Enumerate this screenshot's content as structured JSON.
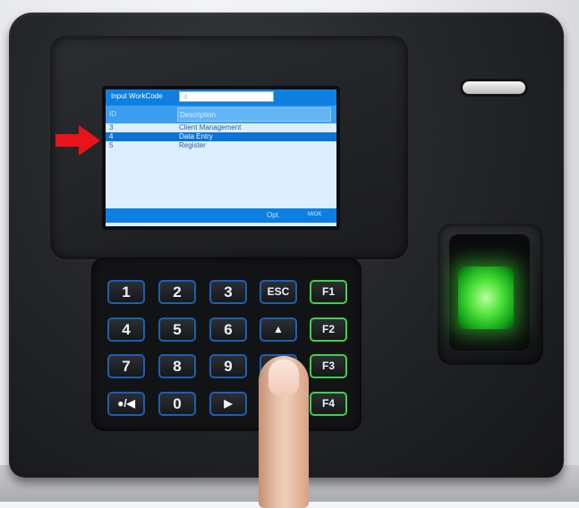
{
  "screen": {
    "input_label": "Input WorkCode",
    "input_value": "4",
    "header_col1": "ID",
    "header_col2": "Description",
    "rows": [
      {
        "id": "3",
        "desc": "Client Management",
        "selected": false
      },
      {
        "id": "4",
        "desc": "Data Entry",
        "selected": true
      },
      {
        "id": "5",
        "desc": "Register",
        "selected": false
      }
    ],
    "footer_opt": "Opt.",
    "footer_ok": "M/OK"
  },
  "keypad": {
    "row1": [
      "1",
      "2",
      "3",
      "ESC",
      "F1"
    ],
    "row2": [
      "4",
      "5",
      "6",
      "▲",
      "F2"
    ],
    "row3": [
      "7",
      "8",
      "9",
      "▼",
      "F3"
    ],
    "row4": [
      "●/◀",
      "0",
      "▶",
      "",
      "F4"
    ]
  },
  "colors": {
    "screen_blue": "#0d7fe0",
    "selection_blue": "#0b73d6",
    "key_border_blue": "#1d5fb0",
    "fn_key_green": "#3fd14a",
    "arrow_red": "#e8141a",
    "scanner_glow": "#4fe23a"
  },
  "icons": [
    "red-arrow-icon",
    "up-arrow-icon",
    "down-arrow-icon",
    "right-arrow-icon",
    "back-arrow-icon"
  ]
}
